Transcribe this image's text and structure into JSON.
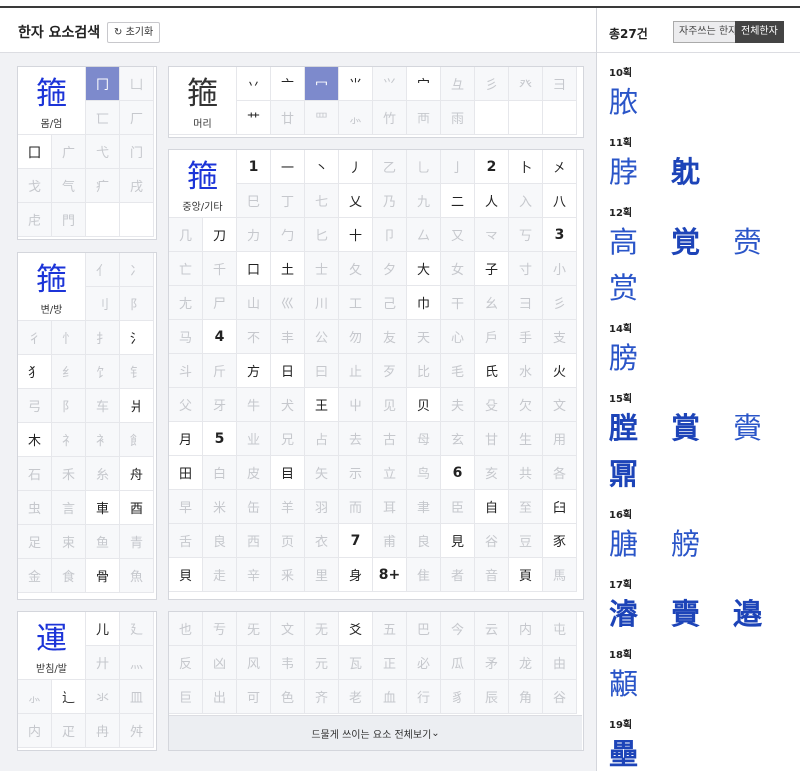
{
  "header": {
    "title": "한자 요소검색",
    "reset_label": "초기화",
    "reset_icon": "refresh-icon"
  },
  "panels": {
    "enclosure": {
      "char": "箍",
      "label": "몸/엄",
      "cells": [
        {
          "t": "冂",
          "s": "sel"
        },
        {
          "t": "凵",
          "s": "off"
        },
        {
          "t": "匸",
          "s": "off"
        },
        {
          "t": "厂",
          "s": "off"
        },
        {
          "t": "囗",
          "s": "on"
        },
        {
          "t": "广",
          "s": "off"
        },
        {
          "t": "弋",
          "s": "off"
        },
        {
          "t": "门",
          "s": "off"
        },
        {
          "t": "戈",
          "s": "off"
        },
        {
          "t": "气",
          "s": "off"
        },
        {
          "t": "疒",
          "s": "off"
        },
        {
          "t": "戌",
          "s": "off"
        },
        {
          "t": "虍",
          "s": "off"
        },
        {
          "t": "門",
          "s": "off"
        },
        {
          "t": "",
          "s": "on"
        },
        {
          "t": "",
          "s": "on"
        }
      ]
    },
    "top": {
      "char": "箍",
      "label": "머리",
      "cells": [
        {
          "t": "丷",
          "s": "on"
        },
        {
          "t": "亠",
          "s": "on"
        },
        {
          "t": "冖",
          "s": "sel"
        },
        {
          "t": "⺌",
          "s": "on"
        },
        {
          "t": "⺍",
          "s": "off"
        },
        {
          "t": "宀",
          "s": "on"
        },
        {
          "t": "彑",
          "s": "off"
        },
        {
          "t": "彡",
          "s": "off"
        },
        {
          "t": "癶",
          "s": "off"
        },
        {
          "t": "⺕",
          "s": "off"
        },
        {
          "t": "艹",
          "s": "on"
        },
        {
          "t": "廿",
          "s": "off"
        },
        {
          "t": "罒",
          "s": "off"
        },
        {
          "t": "⺗",
          "s": "off"
        },
        {
          "t": "竹",
          "s": "off"
        },
        {
          "t": "襾",
          "s": "off"
        },
        {
          "t": "雨",
          "s": "off"
        },
        {
          "t": "",
          "s": "on"
        },
        {
          "t": "",
          "s": "on"
        },
        {
          "t": "",
          "s": "on"
        }
      ]
    },
    "middle": {
      "char": "箍",
      "label": "중앙/기타",
      "cells": [
        {
          "t": "1",
          "s": "num"
        },
        {
          "t": "一",
          "s": "on"
        },
        {
          "t": "丶",
          "s": "on"
        },
        {
          "t": "丿",
          "s": "on"
        },
        {
          "t": "乙",
          "s": "off"
        },
        {
          "t": "乚",
          "s": "off"
        },
        {
          "t": "亅",
          "s": "off"
        },
        {
          "t": "2",
          "s": "num"
        },
        {
          "t": "卜",
          "s": "on"
        },
        {
          "t": "㐅",
          "s": "on"
        },
        {
          "t": "巳",
          "s": "off"
        },
        {
          "t": "丁",
          "s": "off"
        },
        {
          "t": "七",
          "s": "off"
        },
        {
          "t": "乂",
          "s": "on"
        },
        {
          "t": "乃",
          "s": "off"
        },
        {
          "t": "九",
          "s": "off"
        },
        {
          "t": "二",
          "s": "on"
        },
        {
          "t": "人",
          "s": "on"
        },
        {
          "t": "入",
          "s": "off"
        },
        {
          "t": "八",
          "s": "on"
        },
        {
          "t": "几",
          "s": "off"
        },
        {
          "t": "刀",
          "s": "on"
        },
        {
          "t": "力",
          "s": "off"
        },
        {
          "t": "勹",
          "s": "off"
        },
        {
          "t": "匕",
          "s": "off"
        },
        {
          "t": "十",
          "s": "on"
        },
        {
          "t": "卩",
          "s": "off"
        },
        {
          "t": "厶",
          "s": "off"
        },
        {
          "t": "又",
          "s": "off"
        },
        {
          "t": "龴",
          "s": "off"
        },
        {
          "t": "丂",
          "s": "off"
        },
        {
          "t": "3",
          "s": "num"
        },
        {
          "t": "亡",
          "s": "off"
        },
        {
          "t": "千",
          "s": "off"
        },
        {
          "t": "口",
          "s": "on"
        },
        {
          "t": "土",
          "s": "on"
        },
        {
          "t": "士",
          "s": "off"
        },
        {
          "t": "夂",
          "s": "off"
        },
        {
          "t": "夕",
          "s": "off"
        },
        {
          "t": "大",
          "s": "on"
        },
        {
          "t": "女",
          "s": "off"
        },
        {
          "t": "子",
          "s": "on"
        },
        {
          "t": "寸",
          "s": "off"
        },
        {
          "t": "小",
          "s": "off"
        },
        {
          "t": "尢",
          "s": "off"
        },
        {
          "t": "尸",
          "s": "off"
        },
        {
          "t": "山",
          "s": "off"
        },
        {
          "t": "巛",
          "s": "off"
        },
        {
          "t": "川",
          "s": "off"
        },
        {
          "t": "工",
          "s": "off"
        },
        {
          "t": "己",
          "s": "off"
        },
        {
          "t": "巾",
          "s": "on"
        },
        {
          "t": "干",
          "s": "off"
        },
        {
          "t": "幺",
          "s": "off"
        },
        {
          "t": "彐",
          "s": "off"
        },
        {
          "t": "彡",
          "s": "off"
        },
        {
          "t": "马",
          "s": "off"
        },
        {
          "t": "4",
          "s": "num"
        },
        {
          "t": "不",
          "s": "off"
        },
        {
          "t": "丰",
          "s": "off"
        },
        {
          "t": "公",
          "s": "off"
        },
        {
          "t": "勿",
          "s": "off"
        },
        {
          "t": "友",
          "s": "off"
        },
        {
          "t": "天",
          "s": "off"
        },
        {
          "t": "心",
          "s": "off"
        },
        {
          "t": "戶",
          "s": "off"
        },
        {
          "t": "手",
          "s": "off"
        },
        {
          "t": "支",
          "s": "off"
        },
        {
          "t": "斗",
          "s": "off"
        },
        {
          "t": "斤",
          "s": "off"
        },
        {
          "t": "方",
          "s": "on"
        },
        {
          "t": "日",
          "s": "on"
        },
        {
          "t": "曰",
          "s": "off"
        },
        {
          "t": "止",
          "s": "off"
        },
        {
          "t": "歹",
          "s": "off"
        },
        {
          "t": "比",
          "s": "off"
        },
        {
          "t": "毛",
          "s": "off"
        },
        {
          "t": "氏",
          "s": "on"
        },
        {
          "t": "水",
          "s": "off"
        },
        {
          "t": "火",
          "s": "on"
        },
        {
          "t": "父",
          "s": "off"
        },
        {
          "t": "牙",
          "s": "off"
        },
        {
          "t": "牛",
          "s": "off"
        },
        {
          "t": "犬",
          "s": "off"
        },
        {
          "t": "王",
          "s": "on"
        },
        {
          "t": "屮",
          "s": "off"
        },
        {
          "t": "见",
          "s": "off"
        },
        {
          "t": "贝",
          "s": "on"
        },
        {
          "t": "夫",
          "s": "off"
        },
        {
          "t": "殳",
          "s": "off"
        },
        {
          "t": "欠",
          "s": "off"
        },
        {
          "t": "文",
          "s": "off"
        },
        {
          "t": "月",
          "s": "on"
        },
        {
          "t": "5",
          "s": "num"
        },
        {
          "t": "业",
          "s": "off"
        },
        {
          "t": "兄",
          "s": "off"
        },
        {
          "t": "占",
          "s": "off"
        },
        {
          "t": "去",
          "s": "off"
        },
        {
          "t": "古",
          "s": "off"
        },
        {
          "t": "母",
          "s": "off"
        },
        {
          "t": "玄",
          "s": "off"
        },
        {
          "t": "甘",
          "s": "off"
        },
        {
          "t": "生",
          "s": "off"
        },
        {
          "t": "用",
          "s": "off"
        },
        {
          "t": "田",
          "s": "on"
        },
        {
          "t": "白",
          "s": "off"
        },
        {
          "t": "皮",
          "s": "off"
        },
        {
          "t": "目",
          "s": "on"
        },
        {
          "t": "矢",
          "s": "off"
        },
        {
          "t": "示",
          "s": "off"
        },
        {
          "t": "立",
          "s": "off"
        },
        {
          "t": "鸟",
          "s": "off"
        },
        {
          "t": "6",
          "s": "num"
        },
        {
          "t": "亥",
          "s": "off"
        },
        {
          "t": "共",
          "s": "off"
        },
        {
          "t": "各",
          "s": "off"
        },
        {
          "t": "早",
          "s": "off"
        },
        {
          "t": "米",
          "s": "off"
        },
        {
          "t": "缶",
          "s": "off"
        },
        {
          "t": "羊",
          "s": "off"
        },
        {
          "t": "羽",
          "s": "off"
        },
        {
          "t": "而",
          "s": "off"
        },
        {
          "t": "耳",
          "s": "off"
        },
        {
          "t": "聿",
          "s": "off"
        },
        {
          "t": "臣",
          "s": "off"
        },
        {
          "t": "自",
          "s": "on"
        },
        {
          "t": "至",
          "s": "off"
        },
        {
          "t": "臼",
          "s": "on"
        },
        {
          "t": "舌",
          "s": "off"
        },
        {
          "t": "良",
          "s": "off"
        },
        {
          "t": "西",
          "s": "off"
        },
        {
          "t": "页",
          "s": "off"
        },
        {
          "t": "衣",
          "s": "off"
        },
        {
          "t": "7",
          "s": "num"
        },
        {
          "t": "甫",
          "s": "off"
        },
        {
          "t": "良",
          "s": "off"
        },
        {
          "t": "見",
          "s": "on"
        },
        {
          "t": "谷",
          "s": "off"
        },
        {
          "t": "豆",
          "s": "off"
        },
        {
          "t": "豕",
          "s": "on"
        },
        {
          "t": "貝",
          "s": "on"
        },
        {
          "t": "走",
          "s": "off"
        },
        {
          "t": "辛",
          "s": "off"
        },
        {
          "t": "釆",
          "s": "off"
        },
        {
          "t": "里",
          "s": "off"
        },
        {
          "t": "身",
          "s": "on"
        },
        {
          "t": "8+",
          "s": "num"
        },
        {
          "t": "隹",
          "s": "off"
        },
        {
          "t": "者",
          "s": "off"
        },
        {
          "t": "音",
          "s": "off"
        },
        {
          "t": "頁",
          "s": "on"
        },
        {
          "t": "馬",
          "s": "off"
        }
      ]
    },
    "side": {
      "char": "箍",
      "label": "변/방",
      "cells": [
        {
          "t": "亻",
          "s": "off"
        },
        {
          "t": "冫",
          "s": "off"
        },
        {
          "t": "刂",
          "s": "off"
        },
        {
          "t": "阝",
          "s": "off"
        },
        {
          "t": "彳",
          "s": "off"
        },
        {
          "t": "忄",
          "s": "off"
        },
        {
          "t": "扌",
          "s": "off"
        },
        {
          "t": "氵",
          "s": "on"
        },
        {
          "t": "犭",
          "s": "on"
        },
        {
          "t": "纟",
          "s": "off"
        },
        {
          "t": "饣",
          "s": "off"
        },
        {
          "t": "钅",
          "s": "off"
        },
        {
          "t": "弓",
          "s": "off"
        },
        {
          "t": "阝",
          "s": "off"
        },
        {
          "t": "车",
          "s": "off"
        },
        {
          "t": "爿",
          "s": "on"
        },
        {
          "t": "木",
          "s": "on"
        },
        {
          "t": "礻",
          "s": "off"
        },
        {
          "t": "衤",
          "s": "off"
        },
        {
          "t": "飠",
          "s": "off"
        },
        {
          "t": "石",
          "s": "off"
        },
        {
          "t": "禾",
          "s": "off"
        },
        {
          "t": "糸",
          "s": "off"
        },
        {
          "t": "舟",
          "s": "on"
        },
        {
          "t": "虫",
          "s": "off"
        },
        {
          "t": "言",
          "s": "off"
        },
        {
          "t": "車",
          "s": "on"
        },
        {
          "t": "酉",
          "s": "on"
        },
        {
          "t": "足",
          "s": "off"
        },
        {
          "t": "束",
          "s": "off"
        },
        {
          "t": "鱼",
          "s": "off"
        },
        {
          "t": "青",
          "s": "off"
        },
        {
          "t": "金",
          "s": "off"
        },
        {
          "t": "食",
          "s": "off"
        },
        {
          "t": "骨",
          "s": "on"
        },
        {
          "t": "魚",
          "s": "off"
        }
      ]
    },
    "bottom": {
      "char": "運",
      "label": "받침/발",
      "cells": [
        {
          "t": "儿",
          "s": "on"
        },
        {
          "t": "廴",
          "s": "off"
        },
        {
          "t": "廾",
          "s": "off"
        },
        {
          "t": "灬",
          "s": "off"
        },
        {
          "t": "⺗",
          "s": "off"
        },
        {
          "t": "辶",
          "s": "on"
        },
        {
          "t": "氺",
          "s": "off"
        },
        {
          "t": "皿",
          "s": "off"
        },
        {
          "t": "内",
          "s": "off"
        },
        {
          "t": "疋",
          "s": "off"
        },
        {
          "t": "冉",
          "s": "off"
        },
        {
          "t": "舛",
          "s": "off"
        }
      ]
    },
    "rare": {
      "more_label": "드물게 쓰이는 요소 전체보기",
      "cells": [
        {
          "t": "也",
          "s": "off"
        },
        {
          "t": "亐",
          "s": "off"
        },
        {
          "t": "旡",
          "s": "off"
        },
        {
          "t": "文",
          "s": "off"
        },
        {
          "t": "无",
          "s": "off"
        },
        {
          "t": "爻",
          "s": "on"
        },
        {
          "t": "五",
          "s": "off"
        },
        {
          "t": "巴",
          "s": "off"
        },
        {
          "t": "今",
          "s": "off"
        },
        {
          "t": "云",
          "s": "off"
        },
        {
          "t": "内",
          "s": "off"
        },
        {
          "t": "屯",
          "s": "off"
        },
        {
          "t": "反",
          "s": "off"
        },
        {
          "t": "凶",
          "s": "off"
        },
        {
          "t": "风",
          "s": "off"
        },
        {
          "t": "韦",
          "s": "off"
        },
        {
          "t": "元",
          "s": "off"
        },
        {
          "t": "瓦",
          "s": "off"
        },
        {
          "t": "正",
          "s": "off"
        },
        {
          "t": "必",
          "s": "off"
        },
        {
          "t": "瓜",
          "s": "off"
        },
        {
          "t": "矛",
          "s": "off"
        },
        {
          "t": "龙",
          "s": "off"
        },
        {
          "t": "由",
          "s": "off"
        },
        {
          "t": "巨",
          "s": "off"
        },
        {
          "t": "出",
          "s": "off"
        },
        {
          "t": "可",
          "s": "off"
        },
        {
          "t": "色",
          "s": "off"
        },
        {
          "t": "齐",
          "s": "off"
        },
        {
          "t": "老",
          "s": "off"
        },
        {
          "t": "血",
          "s": "off"
        },
        {
          "t": "行",
          "s": "off"
        },
        {
          "t": "豸",
          "s": "off"
        },
        {
          "t": "辰",
          "s": "off"
        },
        {
          "t": "角",
          "s": "off"
        },
        {
          "t": "谷",
          "s": "off"
        }
      ]
    }
  },
  "results": {
    "total": "총27건",
    "toggle_frequent": "자주쓰는 한자",
    "toggle_all": "전체한자",
    "groups": [
      {
        "stroke": "10획",
        "chars": [
          {
            "c": "脓",
            "b": false
          }
        ]
      },
      {
        "stroke": "11획",
        "chars": [
          {
            "c": "脖",
            "b": false
          },
          {
            "c": "躭",
            "b": true
          }
        ]
      },
      {
        "stroke": "12획",
        "chars": [
          {
            "c": "高",
            "b": false
          },
          {
            "c": "覚",
            "b": true
          },
          {
            "c": "赍",
            "b": false
          },
          {
            "c": "赏",
            "b": false
          }
        ]
      },
      {
        "stroke": "14획",
        "chars": [
          {
            "c": "膀",
            "b": false
          }
        ]
      },
      {
        "stroke": "15획",
        "chars": [
          {
            "c": "膛",
            "b": true
          },
          {
            "c": "賞",
            "b": true
          },
          {
            "c": "賫",
            "b": false
          },
          {
            "c": "鼏",
            "b": true
          }
        ]
      },
      {
        "stroke": "16획",
        "chars": [
          {
            "c": "膅",
            "b": false
          },
          {
            "c": "艕",
            "b": false
          }
        ]
      },
      {
        "stroke": "17획",
        "chars": [
          {
            "c": "濬",
            "b": true
          },
          {
            "c": "賷",
            "b": true
          },
          {
            "c": "邉",
            "b": true
          }
        ]
      },
      {
        "stroke": "18획",
        "chars": [
          {
            "c": "顢",
            "b": false
          }
        ]
      },
      {
        "stroke": "19획",
        "chars": [
          {
            "c": "壘",
            "b": true
          }
        ]
      }
    ]
  }
}
